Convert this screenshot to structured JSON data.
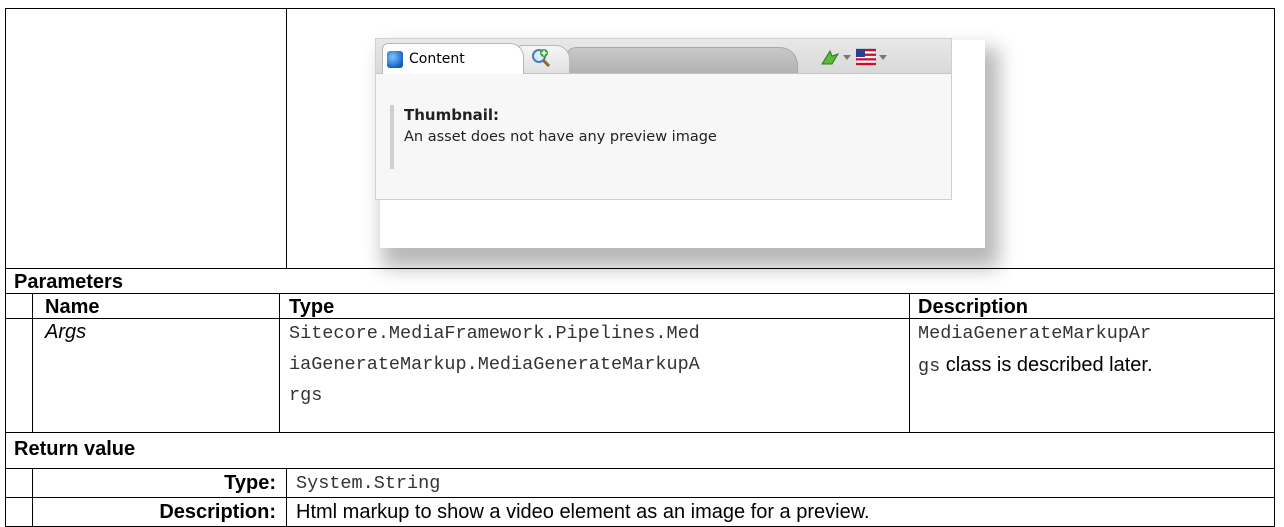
{
  "screenshot": {
    "tab_content_label": "Content",
    "field_title": "Thumbnail:",
    "field_message": "An asset does not have any preview image"
  },
  "parameters": {
    "section_title": "Parameters",
    "headers": {
      "name": "Name",
      "type": "Type",
      "description": "Description"
    },
    "rows": [
      {
        "name": "Args",
        "type_lines": [
          "Sitecore.MediaFramework.Pipelines.Med",
          "iaGenerateMarkup.MediaGenerateMarkupA",
          "rgs"
        ],
        "description_code_line1": "MediaGenerateMarkupAr",
        "description_code_line2": "gs",
        "description_text": " class is described later."
      }
    ]
  },
  "return_value": {
    "section_title": "Return value",
    "type_label": "Type:",
    "type_value": "System.String",
    "description_label": "Description:",
    "description_value": "Html markup to show a video element as an image for a preview."
  }
}
